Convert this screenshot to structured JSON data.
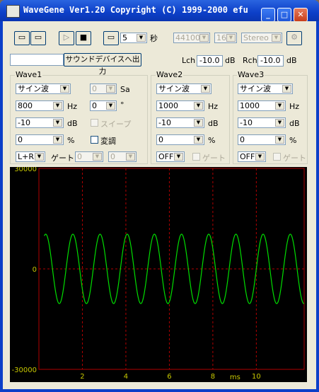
{
  "window": {
    "title": "WaveGene  Ver1.20  Copyright (C) 1999-2000 efu"
  },
  "toolbar": {
    "duration_value": "5",
    "duration_unit": "秒",
    "sample_rate": "44100",
    "bits": "16",
    "channels": "Stereo"
  },
  "output": {
    "button_label": "サウンドデバイスへ出力",
    "lch_label": "Lch",
    "lch_value": "-10.0",
    "rch_label": "Rch",
    "rch_value": "-10.0",
    "db_unit": "dB"
  },
  "wave1": {
    "label": "Wave1",
    "waveform": "サイン波",
    "sub_value": "0",
    "sub_unit": "Sa",
    "frequency": "800",
    "freq_unit": "Hz",
    "phase": "0",
    "phase_unit": "°",
    "level": "-10",
    "level_unit": "dB",
    "sweep_label": "スイープ",
    "offset": "0",
    "offset_unit": "%",
    "modulation_label": "変調",
    "channel": "L+R",
    "gate_label": "ゲート:",
    "gate_a": "0",
    "gate_b": "0"
  },
  "wave2": {
    "label": "Wave2",
    "waveform": "サイン波",
    "frequency": "1000",
    "freq_unit": "Hz",
    "level": "-10",
    "level_unit": "dB",
    "offset": "0",
    "offset_unit": "%",
    "channel": "OFF",
    "gate_label": "ゲート"
  },
  "wave3": {
    "label": "Wave3",
    "waveform": "サイン波",
    "frequency": "1000",
    "freq_unit": "Hz",
    "level": "-10",
    "level_unit": "dB",
    "offset": "0",
    "offset_unit": "%",
    "channel": "OFF",
    "gate_label": "ゲート"
  },
  "chart_data": {
    "type": "line",
    "title": "",
    "xlabel": "ms",
    "ylabel": "",
    "xlim": [
      0,
      12.2
    ],
    "ylim": [
      -30000,
      30000
    ],
    "x_ticks": [
      "2",
      "4",
      "6",
      "8",
      "10"
    ],
    "y_ticks": [
      "30000",
      "0",
      "-30000"
    ],
    "grid": true,
    "series": [
      {
        "frequency_hz": 800,
        "amplitude": 10362,
        "color": "#00dd00",
        "x_start_ms": 0.25,
        "x_end_ms": 12.2
      }
    ],
    "colors": {
      "background": "#000000",
      "grid": "#b00000",
      "axis_text": "#c8c800"
    }
  }
}
